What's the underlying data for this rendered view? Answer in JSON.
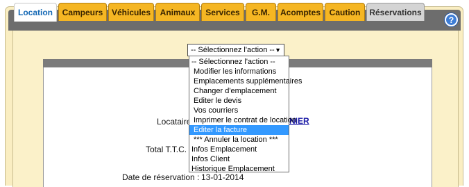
{
  "tabs": [
    {
      "label": "Location",
      "state": "active"
    },
    {
      "label": "Campeurs",
      "state": "normal"
    },
    {
      "label": "Véhicules",
      "state": "normal"
    },
    {
      "label": "Animaux",
      "state": "normal"
    },
    {
      "label": "Services",
      "state": "normal"
    },
    {
      "label": "G.M.",
      "state": "normal"
    },
    {
      "label": "Acomptes",
      "state": "normal"
    },
    {
      "label": "Caution",
      "state": "normal"
    },
    {
      "label": "Réservations",
      "state": "disabled"
    }
  ],
  "help": {
    "label": "?"
  },
  "action_select": {
    "value": "-- Sélectionnez l'action --",
    "options": [
      "-- Sélectionnez l'action --",
      "Modifier les informations",
      "Emplacements supplémentaires",
      "Changer d'emplacement",
      "Editer le devis",
      "Vos courriers",
      "Imprimer le contrat de location",
      "Editer la facture",
      "*** Annuler la location ***",
      "Infos Emplacement",
      "Infos Client",
      "Historique Emplacement"
    ],
    "highlighted": "Editer la facture"
  },
  "form": {
    "locataire_label": "Locataire",
    "locataire_value_visible": "NIER",
    "total_label": "Total T.T.C.",
    "date_label": "Date de réservation :",
    "date_value": "13-01-2014"
  },
  "colors": {
    "tab_bg": "#f5b623",
    "tab_bar": "#6d6d6d",
    "content_bg": "#fbf1c9",
    "selection": "#3399ff",
    "link": "#1a1aa6"
  }
}
